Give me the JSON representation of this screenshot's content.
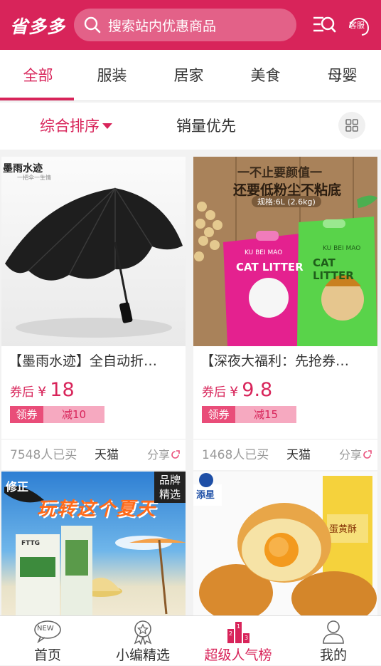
{
  "header": {
    "logo": "省多多",
    "search_placeholder": "搜索站内优惠商品",
    "customer_service": "客服"
  },
  "categories": [
    "全部",
    "服装",
    "居家",
    "美食",
    "母婴"
  ],
  "sort": {
    "comprehensive": "综合排序",
    "sales": "销量优先"
  },
  "products": [
    {
      "image_text": "墨雨水迹",
      "image_subtext": "一把伞一生情",
      "title": "【墨雨水迹】全自动折…",
      "price_label": "券后",
      "currency": "¥",
      "price": "18",
      "coupon_label": "领券",
      "coupon_value": "减10",
      "sold": "7548人已买",
      "shop": "天猫",
      "share": "分享"
    },
    {
      "image_text": "一不止要颜值一",
      "image_text2": "还要低粉尘不粘底",
      "image_spec": "规格:6L (2.6kg)",
      "image_bag": "CAT LITTER",
      "image_bag_brand": "KU BEI MAO",
      "title": "【深夜大福利：先抢券…",
      "price_label": "券后",
      "currency": "¥",
      "price": "9.8",
      "coupon_label": "领券",
      "coupon_value": "减15",
      "sold": "1468人已买",
      "shop": "天猫",
      "share": "分享"
    },
    {
      "image_text": "玩转这个夏天",
      "image_badge": "品牌精选",
      "image_logo": "修正",
      "image_box": "FTTG"
    },
    {
      "image_text": "添星",
      "image_box": "蛋黄酥"
    }
  ],
  "tabbar": [
    {
      "label": "首页",
      "icon": "new-bubble-icon",
      "badge": "NEW"
    },
    {
      "label": "小编精选",
      "icon": "award-icon"
    },
    {
      "label": "超级人气榜",
      "icon": "podium-icon",
      "active": true
    },
    {
      "label": "我的",
      "icon": "user-icon"
    }
  ],
  "colors": {
    "brand": "#d8245a",
    "coupon_dark": "#e94d79",
    "coupon_light": "#f6a9c0"
  }
}
